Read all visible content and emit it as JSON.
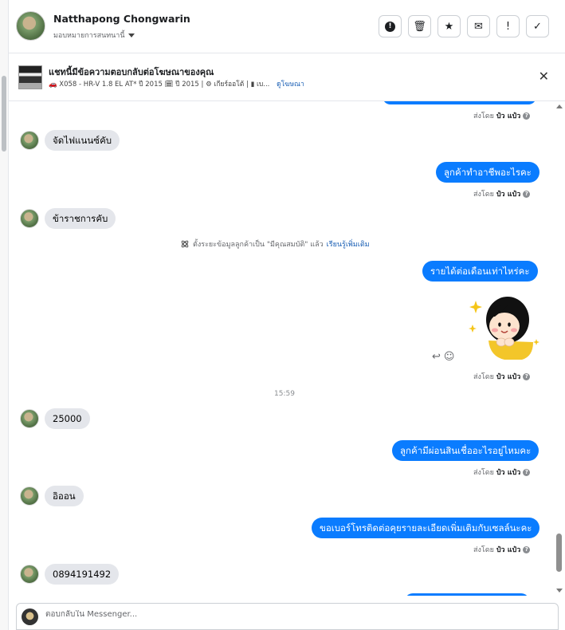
{
  "header": {
    "name": "Natthapong Chongwarin",
    "assign_label": "มอบหมายการสนทนานี้",
    "actions": [
      {
        "name": "spam-icon",
        "label": "!"
      },
      {
        "name": "trash-icon",
        "label": "🗑"
      },
      {
        "name": "star-icon",
        "label": "★"
      },
      {
        "name": "mark-unread-icon",
        "label": "✉"
      },
      {
        "name": "follow-up-icon",
        "label": "!"
      },
      {
        "name": "done-icon",
        "label": "✓"
      }
    ]
  },
  "ad": {
    "title": "แชทนี้มีข้อความตอบกลับต่อโฆษณาของคุณ",
    "meta": "🚗 X058 - HR-V 1.8 EL AT* ปี 2015 🗓 ปี 2015 | ⚙ เกียร์ออโต้ | ▮ เบ...",
    "link": "ดูโฆษณา"
  },
  "messages": {
    "sent_prefix": "ส่งโดย",
    "sent_by": "ป๋ว แป๋ว",
    "qmark": "?",
    "in1": "จัดไฟแนนซ์คับ",
    "out1": "ลูกค้าทำอาชีพอะไรคะ",
    "in2": "ข้าราชการคับ",
    "system_text": "ตั้งระยะข้อมูลลูกค้าเป็น \"มีคุณสมบัติ\" แล้ว",
    "system_link": "เรียนรู้เพิ่มเติม",
    "out2": "รายได้ต่อเดือนเท่าไหร่คะ",
    "time": "15:59",
    "in3": "25000",
    "out3": "ลูกค้ามีผ่อนสินเชื่ออะไรอยู่ไหมคะ",
    "in4": "อิออน",
    "out4": "ขอเบอร์โทรติดต่อคุยรายละเอียดเพิ่มเติมกับเซลล์นะคะ",
    "in5": "0894191492"
  },
  "composer": {
    "placeholder": "ตอบกลับใน Messenger..."
  },
  "colors": {
    "outgoing_bubble": "#0a7cff",
    "incoming_bubble": "#e4e6eb"
  }
}
